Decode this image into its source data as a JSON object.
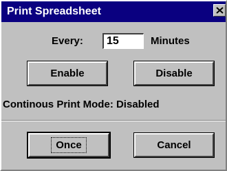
{
  "window": {
    "title": "Print Spreadsheet"
  },
  "interval": {
    "label": "Every:",
    "value": "15",
    "unit": "Minutes"
  },
  "buttons": {
    "enable": "Enable",
    "disable": "Disable",
    "once": "Once",
    "cancel": "Cancel"
  },
  "status": {
    "text": "Continous Print Mode: Disabled"
  },
  "icons": {
    "close": "close-icon"
  },
  "colors": {
    "titlebar": "#0a0080",
    "face": "#c0c0c0"
  }
}
